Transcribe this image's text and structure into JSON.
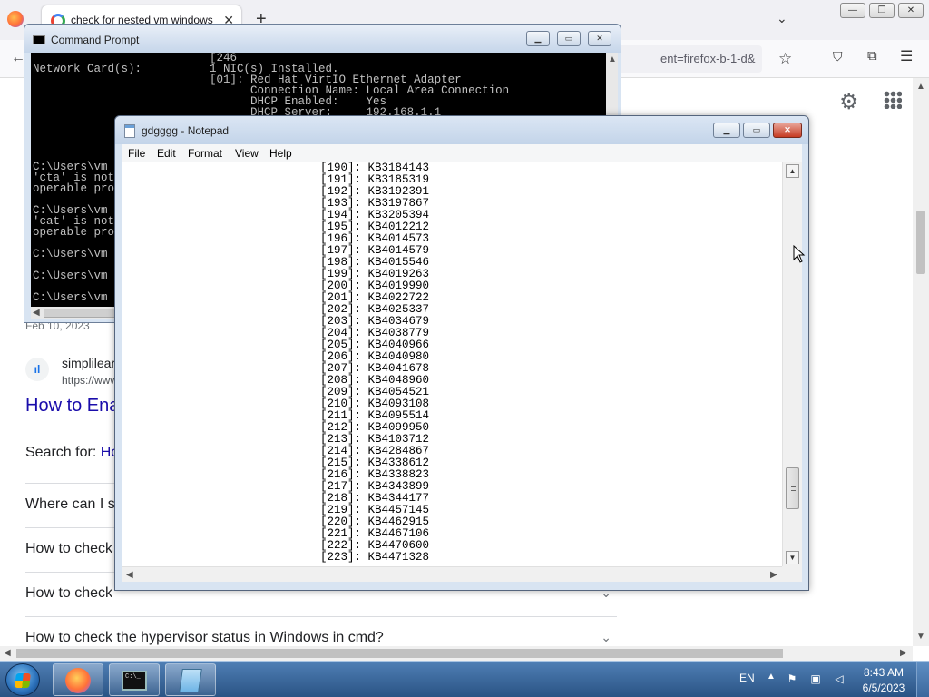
{
  "firefox": {
    "tab_title": "check for nested vm windows",
    "tab_close": "✕",
    "new_tab": "+",
    "list_all_tabs": "⌄",
    "window_controls": {
      "minimize": "—",
      "restore": "❐",
      "close": "✕"
    },
    "back": "←",
    "url_visible": "ent=firefox-b-1-d&",
    "star": "☆",
    "pocket": "⛉",
    "extensions": "⧉",
    "menu": "☰"
  },
  "google": {
    "settings_icon": "⚙",
    "result_date": "Feb 10, 2023",
    "site_icon_glyph": "ıl",
    "site_name": "simplilear",
    "site_url": "https://www",
    "result_title": "How to Ena",
    "search_for_label": "Search for: ",
    "search_for_link": "Ho",
    "faq": [
      {
        "question": "Where can I s",
        "chevron": "⌄"
      },
      {
        "question": "How to check",
        "chevron": "⌄"
      },
      {
        "question": "How to check",
        "chevron": "⌄"
      },
      {
        "question": "How to check the hypervisor status in Windows in cmd?",
        "chevron": "⌄"
      }
    ]
  },
  "cmd": {
    "title": "Command Prompt",
    "buttons": {
      "minimize": "▁",
      "maximize": "▭",
      "close": "✕"
    },
    "lines": [
      "                          [246",
      "Network Card(s):          1 NIC(s) Installed.",
      "                          [01]: Red Hat VirtIO Ethernet Adapter",
      "                                Connection Name: Local Area Connection",
      "                                DHCP Enabled:    Yes",
      "                                DHCP Server:     192.168.1.1",
      "",
      "",
      "",
      "",
      "C:\\Users\\vm",
      "'cta' is not",
      "operable pro",
      "",
      "C:\\Users\\vm",
      "'cat' is not",
      "operable pro",
      "",
      "C:\\Users\\vm",
      "",
      "C:\\Users\\vm",
      "",
      "C:\\Users\\vm"
    ]
  },
  "notepad": {
    "title": "gdgggg - Notepad",
    "buttons": {
      "minimize": "▁",
      "maximize": "▭",
      "close": "✕"
    },
    "menu": [
      "File",
      "Edit",
      "Format",
      "View",
      "Help"
    ],
    "entries": [
      {
        "index": "[190]:",
        "kb": "KB3184143"
      },
      {
        "index": "[191]:",
        "kb": "KB3185319"
      },
      {
        "index": "[192]:",
        "kb": "KB3192391"
      },
      {
        "index": "[193]:",
        "kb": "KB3197867"
      },
      {
        "index": "[194]:",
        "kb": "KB3205394"
      },
      {
        "index": "[195]:",
        "kb": "KB4012212"
      },
      {
        "index": "[196]:",
        "kb": "KB4014573"
      },
      {
        "index": "[197]:",
        "kb": "KB4014579"
      },
      {
        "index": "[198]:",
        "kb": "KB4015546"
      },
      {
        "index": "[199]:",
        "kb": "KB4019263"
      },
      {
        "index": "[200]:",
        "kb": "KB4019990"
      },
      {
        "index": "[201]:",
        "kb": "KB4022722"
      },
      {
        "index": "[202]:",
        "kb": "KB4025337"
      },
      {
        "index": "[203]:",
        "kb": "KB4034679"
      },
      {
        "index": "[204]:",
        "kb": "KB4038779"
      },
      {
        "index": "[205]:",
        "kb": "KB4040966"
      },
      {
        "index": "[206]:",
        "kb": "KB4040980"
      },
      {
        "index": "[207]:",
        "kb": "KB4041678"
      },
      {
        "index": "[208]:",
        "kb": "KB4048960"
      },
      {
        "index": "[209]:",
        "kb": "KB4054521"
      },
      {
        "index": "[210]:",
        "kb": "KB4093108"
      },
      {
        "index": "[211]:",
        "kb": "KB4095514"
      },
      {
        "index": "[212]:",
        "kb": "KB4099950"
      },
      {
        "index": "[213]:",
        "kb": "KB4103712"
      },
      {
        "index": "[214]:",
        "kb": "KB4284867"
      },
      {
        "index": "[215]:",
        "kb": "KB4338612"
      },
      {
        "index": "[216]:",
        "kb": "KB4338823"
      },
      {
        "index": "[217]:",
        "kb": "KB4343899"
      },
      {
        "index": "[218]:",
        "kb": "KB4344177"
      },
      {
        "index": "[219]:",
        "kb": "KB4457145"
      },
      {
        "index": "[220]:",
        "kb": "KB4462915"
      },
      {
        "index": "[221]:",
        "kb": "KB4467106"
      },
      {
        "index": "[222]:",
        "kb": "KB4470600"
      },
      {
        "index": "[223]:",
        "kb": "KB4471328"
      }
    ]
  },
  "taskbar": {
    "language": "EN",
    "tray_arrow": "▲",
    "time": "8:43 AM",
    "date": "6/5/2023",
    "cmd_icon_text": "C:\\_"
  },
  "colors": {
    "cmd_background": "#000000",
    "cmd_text": "#c0c0c0",
    "google_link": "#1a0dab",
    "taskbar": "#2a5384"
  }
}
